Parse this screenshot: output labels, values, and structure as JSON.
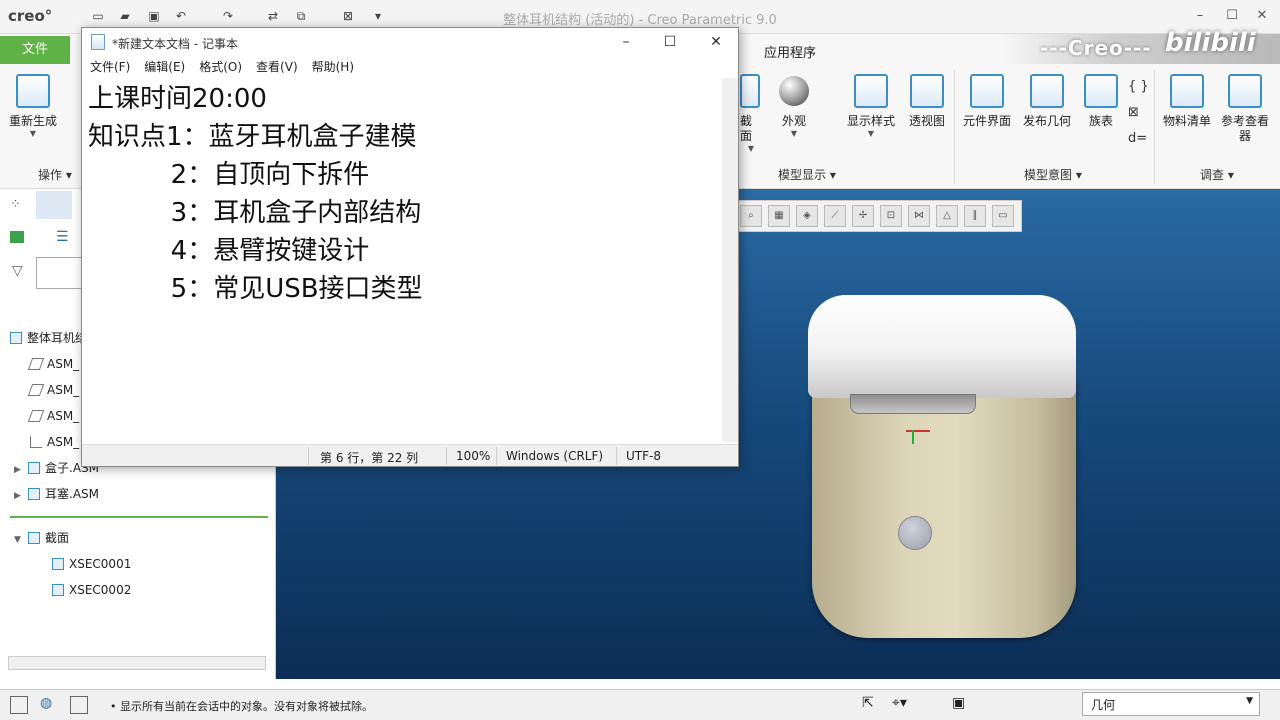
{
  "app": {
    "logo": "creo°",
    "window_title": "整体耳机结构 (活动的) - Creo Parametric 9.0",
    "brand": "---Creo---",
    "watermark": "bilibili"
  },
  "ribbon": {
    "file_tab": "文件",
    "tabs": [
      "应用程序"
    ],
    "buttons": {
      "regenerate": "重新生成",
      "section": "截面",
      "appearance": "外观",
      "display_style": "显示样式",
      "perspective": "透视图",
      "component_interface": "元件界面",
      "publish_geometry": "发布几何",
      "family_table": "族表",
      "bom": "物料清单",
      "reference_viewer": "参考查看器"
    },
    "groups": {
      "operations": "操作",
      "model_display": "模型显示",
      "model_intent": "模型意图",
      "investigate": "调查"
    }
  },
  "model_tree": {
    "root": "整体耳机结",
    "items": [
      {
        "label": "ASM_"
      },
      {
        "label": "ASM_"
      },
      {
        "label": "ASM_"
      },
      {
        "label": "ASM_"
      },
      {
        "label": "盒子.ASM"
      },
      {
        "label": "耳塞.ASM"
      }
    ],
    "sections": {
      "label": "截面",
      "children": [
        "XSEC0001",
        "XSEC0002"
      ]
    }
  },
  "notepad": {
    "title": "*新建文本文档 - 记事本",
    "menu": [
      "文件(F)",
      "编辑(E)",
      "格式(O)",
      "查看(V)",
      "帮助(H)"
    ],
    "content": "上课时间20:00\n知识点1：蓝牙耳机盒子建模\n          2：自顶向下拆件\n          3：耳机盒子内部结构\n          4：悬臂按键设计\n          5：常见USB接口类型",
    "status": {
      "position": "第 6 行，第 22 列",
      "zoom": "100%",
      "line_ending": "Windows (CRLF)",
      "encoding": "UTF-8"
    }
  },
  "statusbar": {
    "message": "• 显示所有当前在会话中的对象。没有对象将被拭除。",
    "filter_value": "几何"
  }
}
